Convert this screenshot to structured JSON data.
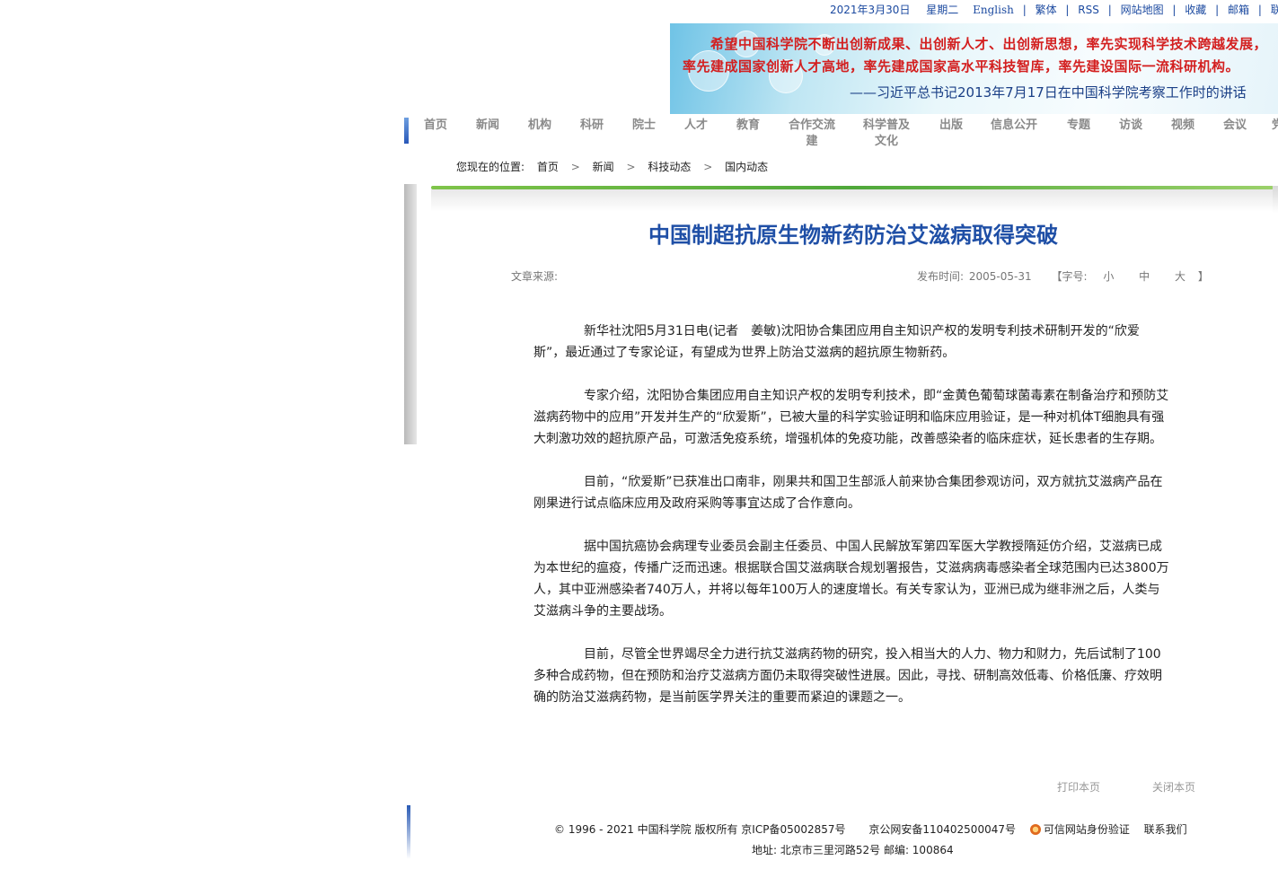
{
  "topbar": {
    "date": "2021年3月30日",
    "weekday": "星期二",
    "links": [
      "English",
      "繁体",
      "RSS",
      "网站地图",
      "收藏",
      "邮箱",
      "联系我们"
    ]
  },
  "banner": {
    "quote_line1": "希望中国科学院不断出创新成果、出创新人才、出创新思想，率先实现科学技术跨越发展，",
    "quote_line2": "率先建成国家创新人才高地，率先建成国家高水平科技智库，率先建设国际一流科研机构。",
    "source": "——习近平总书记2013年7月17日在中国科学院考察工作时的讲话"
  },
  "nav": {
    "items": [
      "首页",
      "新闻",
      "机构",
      "科研",
      "院士",
      "人才",
      "教育",
      "合作交流\n建",
      "科学普及\n文化",
      "出版",
      "信息公开",
      "专题",
      "访谈",
      "视频",
      "会议",
      "党"
    ]
  },
  "breadcrumb": {
    "label": "您现在的位置:",
    "items": [
      "首页",
      "新闻",
      "科技动态",
      "国内动态"
    ]
  },
  "article": {
    "title": "中国制超抗原生物新药防治艾滋病取得突破",
    "source_label": "文章来源:",
    "publish_label": "发布时间:",
    "publish_date": "2005-05-31",
    "font_label": "【字号:",
    "font_small": "小",
    "font_medium": "中",
    "font_large": "大",
    "font_close": "】",
    "paragraphs": [
      "新华社沈阳5月31日电(记者　姜敏)沈阳协合集团应用自主知识产权的发明专利技术研制开发的“欣爱斯”，最近通过了专家论证，有望成为世界上防治艾滋病的超抗原生物新药。",
      "专家介绍，沈阳协合集团应用自主知识产权的发明专利技术，即“金黄色葡萄球菌毒素在制备治疗和预防艾滋病药物中的应用”开发并生产的“欣爱斯”，已被大量的科学实验证明和临床应用验证，是一种对机体T细胞具有强大刺激功效的超抗原产品，可激活免疫系统，增强机体的免疫功能，改善感染者的临床症状，延长患者的生存期。",
      "目前，“欣爱斯”已获准出口南非，刚果共和国卫生部派人前来协合集团参观访问，双方就抗艾滋病产品在刚果进行试点临床应用及政府采购等事宜达成了合作意向。",
      "据中国抗癌协会病理专业委员会副主任委员、中国人民解放军第四军医大学教授隋延仿介绍，艾滋病已成为本世纪的瘟疫，传播广泛而迅速。根据联合国艾滋病联合规划署报告，艾滋病病毒感染者全球范围内已达3800万人，其中亚洲感染者740万人，并将以每年100万人的速度增长。有关专家认为，亚洲已成为继非洲之后，人类与艾滋病斗争的主要战场。",
      "目前，尽管全世界竭尽全力进行抗艾滋病药物的研究，投入相当大的人力、物力和财力，先后试制了100多种合成药物，但在预防和治疗艾滋病方面仍未取得突破性进展。因此，寻找、研制高效低毒、价格低廉、疗效明确的防治艾滋病药物，是当前医学界关注的重要而紧迫的课题之一。"
    ],
    "print_label": "打印本页",
    "close_label": "关闭本页"
  },
  "footer": {
    "copyright": "© 1996 - 2021 中国科学院 版权所有 京ICP备05002857号",
    "police": "京公网安备110402500047号",
    "trust": "可信网站身份验证",
    "contact": "联系我们",
    "address": "地址: 北京市三里河路52号 邮编: 100864"
  }
}
